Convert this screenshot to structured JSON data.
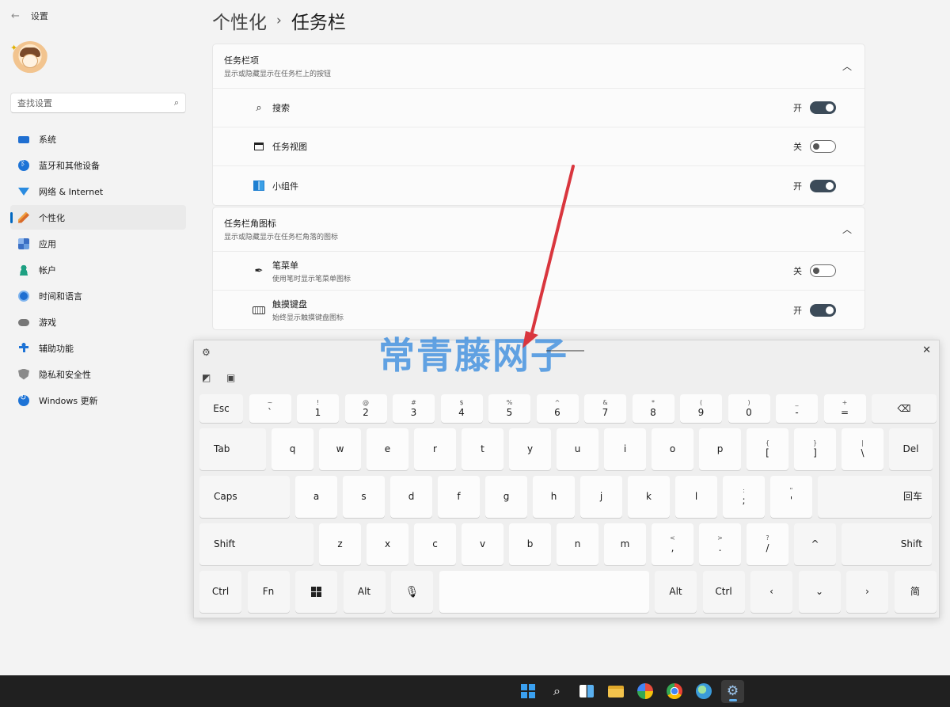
{
  "app": {
    "title": "设置",
    "back_icon": "back-arrow-icon"
  },
  "search": {
    "placeholder": "查找设置"
  },
  "nav": [
    {
      "label": "系统",
      "icon": "monitor-icon"
    },
    {
      "label": "蓝牙和其他设备",
      "icon": "bluetooth-icon"
    },
    {
      "label": "网络 & Internet",
      "icon": "wifi-icon"
    },
    {
      "label": "个性化",
      "icon": "brush-icon",
      "active": true
    },
    {
      "label": "应用",
      "icon": "apps-icon"
    },
    {
      "label": "帐户",
      "icon": "account-icon"
    },
    {
      "label": "时间和语言",
      "icon": "globe-clock-icon"
    },
    {
      "label": "游戏",
      "icon": "gamepad-icon"
    },
    {
      "label": "辅助功能",
      "icon": "accessibility-icon"
    },
    {
      "label": "隐私和安全性",
      "icon": "shield-icon"
    },
    {
      "label": "Windows 更新",
      "icon": "update-icon"
    }
  ],
  "breadcrumb": {
    "parent": "个性化",
    "separator": "›",
    "current": "任务栏"
  },
  "taskbar_items": {
    "title": "任务栏项",
    "subtitle": "显示或隐藏显示在任务栏上的按钮",
    "rows": [
      {
        "label": "搜索",
        "state": "开",
        "on": true,
        "icon": "search-icon"
      },
      {
        "label": "任务视图",
        "state": "关",
        "on": false,
        "icon": "task-view-icon"
      },
      {
        "label": "小组件",
        "state": "开",
        "on": true,
        "icon": "widgets-icon"
      }
    ]
  },
  "corner_icons": {
    "title": "任务栏角图标",
    "subtitle": "显示或隐藏显示在任务栏角落的图标",
    "rows": [
      {
        "label": "笔菜单",
        "sub": "使用笔时显示笔菜单图标",
        "state": "关",
        "on": false,
        "icon": "pen-icon"
      },
      {
        "label": "触摸键盘",
        "sub": "始终显示触摸键盘图标",
        "state": "开",
        "on": true,
        "icon": "keyboard-icon"
      }
    ]
  },
  "keyboard": {
    "row1": [
      {
        "main": "Esc"
      },
      {
        "shift": "~",
        "main": "`"
      },
      {
        "shift": "!",
        "main": "1"
      },
      {
        "shift": "@",
        "main": "2"
      },
      {
        "shift": "#",
        "main": "3"
      },
      {
        "shift": "$",
        "main": "4"
      },
      {
        "shift": "%",
        "main": "5"
      },
      {
        "shift": "^",
        "main": "6"
      },
      {
        "shift": "&",
        "main": "7"
      },
      {
        "shift": "*",
        "main": "8"
      },
      {
        "shift": "(",
        "main": "9"
      },
      {
        "shift": ")",
        "main": "0"
      },
      {
        "shift": "_",
        "main": "-"
      },
      {
        "shift": "+",
        "main": "="
      },
      {
        "main": "⌫"
      }
    ],
    "row2": [
      "Tab",
      "q",
      "w",
      "e",
      "r",
      "t",
      "y",
      "u",
      "i",
      "o",
      "p",
      "[",
      "]",
      "\\",
      "Del"
    ],
    "row2_shift": {
      "[": "{",
      "]": "}",
      "\\": "|"
    },
    "row3": [
      "Caps",
      "a",
      "s",
      "d",
      "f",
      "g",
      "h",
      "j",
      "k",
      "l",
      ";",
      "'",
      "回车"
    ],
    "row3_shift": {
      ";": ":",
      "'": "\""
    },
    "row4": [
      "Shift",
      "z",
      "x",
      "c",
      "v",
      "b",
      "n",
      "m",
      ",",
      ".",
      "/",
      "^",
      "Shift"
    ],
    "row4_shift": {
      ",": "<",
      ".": ">",
      "/": "?"
    },
    "row5": [
      "Ctrl",
      "Fn",
      "win",
      "Alt",
      "mic",
      "space",
      "Alt",
      "Ctrl",
      "‹",
      "⌄",
      "›",
      "简"
    ]
  },
  "watermark": "常青藤网子",
  "colors": {
    "accent": "#0067c0",
    "toggle_on": "#3c4b59",
    "arrow": "#d9363e",
    "taskbar": "#202020"
  }
}
